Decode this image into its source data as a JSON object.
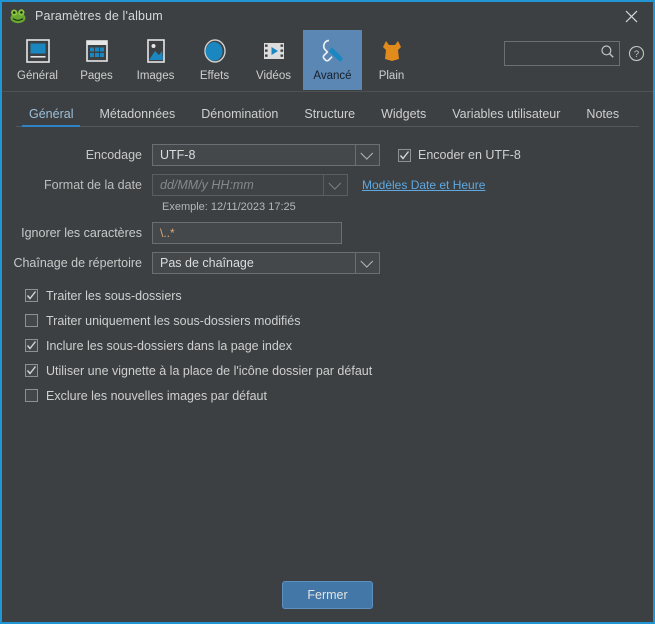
{
  "window": {
    "title": "Paramètres de l'album",
    "app_icon": "frog-logo-icon",
    "close_label": "✕"
  },
  "toolbar": {
    "items": [
      {
        "label": "Général",
        "icon": "general-icon",
        "selected": false
      },
      {
        "label": "Pages",
        "icon": "pages-icon",
        "selected": false
      },
      {
        "label": "Images",
        "icon": "images-icon",
        "selected": false
      },
      {
        "label": "Effets",
        "icon": "effects-icon",
        "selected": false
      },
      {
        "label": "Vidéos",
        "icon": "videos-icon",
        "selected": false
      },
      {
        "label": "Avancé",
        "icon": "wrench-icon",
        "selected": true
      },
      {
        "label": "Plain",
        "icon": "skin-icon",
        "selected": false
      }
    ],
    "search_placeholder": "",
    "search_value": "",
    "search_icon": "search-icon",
    "help_icon": "help-icon"
  },
  "tabs": [
    {
      "label": "Général",
      "active": true
    },
    {
      "label": "Métadonnées",
      "active": false
    },
    {
      "label": "Dénomination",
      "active": false
    },
    {
      "label": "Structure",
      "active": false
    },
    {
      "label": "Widgets",
      "active": false
    },
    {
      "label": "Variables utilisateur",
      "active": false
    },
    {
      "label": "Notes",
      "active": false
    }
  ],
  "form": {
    "encoding": {
      "label": "Encodage",
      "value": "UTF-8",
      "checkbox_label": "Encoder en UTF-8",
      "checkbox_checked": true
    },
    "date_format": {
      "label": "Format de la date",
      "placeholder": "dd/MM/y HH:mm",
      "value": "",
      "disabled": true,
      "link_label": "Modèles Date et Heure",
      "example": "Exemple: 12/11/2023 17:25"
    },
    "ignore_chars": {
      "label": "Ignorer les caractères",
      "value": "\\..*"
    },
    "directory_chaining": {
      "label": "Chaînage de répertoire",
      "value": "Pas de chaînage"
    },
    "checkboxes": [
      {
        "label": "Traiter les sous-dossiers",
        "checked": true
      },
      {
        "label": "Traiter uniquement les sous-dossiers modifiés",
        "checked": false
      },
      {
        "label": "Inclure les sous-dossiers dans la page index",
        "checked": true
      },
      {
        "label": "Utiliser une vignette à la place de l'icône dossier par défaut",
        "checked": true
      },
      {
        "label": "Exclure les nouvelles images par défaut",
        "checked": false
      }
    ]
  },
  "footer": {
    "close_button": "Fermer"
  },
  "colors": {
    "window_bg": "#3c4043",
    "accent_blue": "#2196d4",
    "tab_underline": "#2f82c4",
    "selected_toolbar": "#5b87b5",
    "link": "#5fa8e0",
    "button": "#4377a8",
    "input_text_orange": "#d9a97b"
  }
}
